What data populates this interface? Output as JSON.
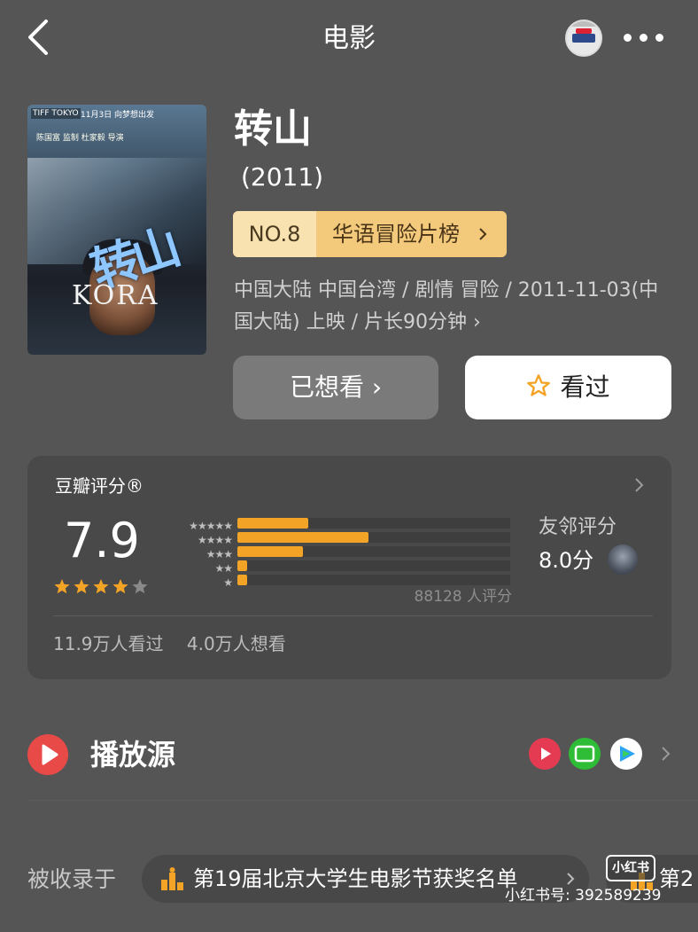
{
  "header": {
    "title": "电影"
  },
  "movie": {
    "title": "转山",
    "year": "(2011)",
    "rank_no": "NO.8",
    "rank_list": "华语冒险片榜",
    "meta_line1": "中国大陆 中国台湾 / 剧情 冒险 / 2011-11-03(中",
    "meta_line2": "国大陆) 上映 / 片长90分钟",
    "poster": {
      "festival": "TIFF TOKYO",
      "release": "11月3日 向梦想出发",
      "credits": "陈国富 监制   杜家毅 导演",
      "title_art": "转山",
      "english_title": "KORA"
    }
  },
  "actions": {
    "want_label": "已想看",
    "seen_label": "看过"
  },
  "rating": {
    "title": "豆瓣评分®",
    "score": "7.9",
    "stars_value": 4,
    "stars_max": 5,
    "distribution": [
      {
        "stars": 5,
        "fraction": 0.26
      },
      {
        "stars": 4,
        "fraction": 0.48
      },
      {
        "stars": 3,
        "fraction": 0.24
      },
      {
        "stars": 2,
        "fraction": 0.035
      },
      {
        "stars": 1,
        "fraction": 0.035
      }
    ],
    "count_text": "88128 人评分",
    "neighbor_label": "友邻评分",
    "neighbor_score": "8.0分",
    "seen_text": "11.9万人看过",
    "want_text": "4.0万人想看"
  },
  "play": {
    "label": "播放源"
  },
  "collections": {
    "label": "被收录于",
    "items": [
      "第19届北京大学生电影节获奖名单",
      "第2"
    ]
  },
  "watermark": {
    "badge": "小红书",
    "id": "小红书号: 392589239"
  },
  "colors": {
    "background": "#555555",
    "accent_orange": "#f3a325",
    "badge_gold": "#f3ca7c"
  }
}
